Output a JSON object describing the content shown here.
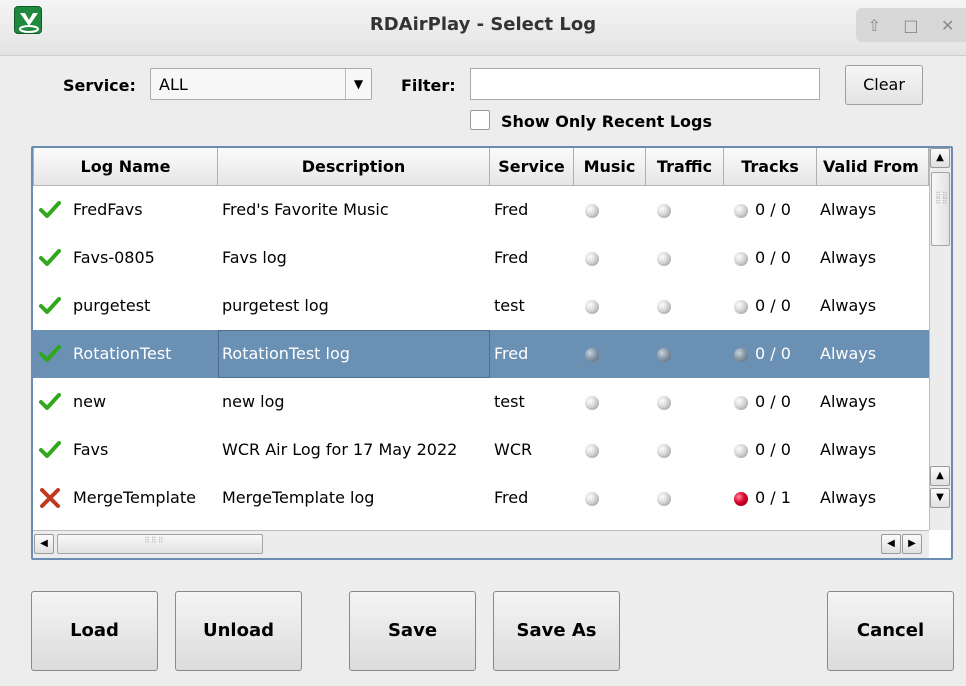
{
  "window": {
    "title": "RDAirPlay - Select Log",
    "controls": [
      "⇧",
      "□",
      "✕"
    ]
  },
  "toolbar": {
    "service_label": "Service:",
    "service_value": "ALL",
    "filter_label": "Filter:",
    "filter_value": "",
    "clear_label": "Clear",
    "recent_label": "Show Only Recent Logs",
    "recent_checked": false
  },
  "table": {
    "columns": [
      "Log Name",
      "Description",
      "Service",
      "Music",
      "Traffic",
      "Tracks",
      "Valid From"
    ],
    "rows": [
      {
        "status": "check-icon",
        "name": "FredFavs",
        "description": "Fred's Favorite Music",
        "service": "Fred",
        "music": "gray",
        "traffic": "gray",
        "tracks_led": "gray",
        "tracks": "0 / 0",
        "valid_from": "Always",
        "selected": false
      },
      {
        "status": "check-icon",
        "name": "Favs-0805",
        "description": "Favs log",
        "service": "Fred",
        "music": "gray",
        "traffic": "gray",
        "tracks_led": "gray",
        "tracks": "0 / 0",
        "valid_from": "Always",
        "selected": false
      },
      {
        "status": "check-icon",
        "name": "purgetest",
        "description": "purgetest log",
        "service": "test",
        "music": "gray",
        "traffic": "gray",
        "tracks_led": "gray",
        "tracks": "0 / 0",
        "valid_from": "Always",
        "selected": false
      },
      {
        "status": "check-icon",
        "name": "RotationTest",
        "description": "RotationTest log",
        "service": "Fred",
        "music": "gray",
        "traffic": "gray",
        "tracks_led": "gray",
        "tracks": "0 / 0",
        "valid_from": "Always",
        "selected": true
      },
      {
        "status": "check-icon",
        "name": "new",
        "description": "new log",
        "service": "test",
        "music": "gray",
        "traffic": "gray",
        "tracks_led": "gray",
        "tracks": "0 / 0",
        "valid_from": "Always",
        "selected": false
      },
      {
        "status": "check-icon",
        "name": "Favs",
        "description": "WCR Air Log for 17 May 2022",
        "service": "WCR",
        "music": "gray",
        "traffic": "gray",
        "tracks_led": "gray",
        "tracks": "0 / 0",
        "valid_from": "Always",
        "selected": false
      },
      {
        "status": "x-icon",
        "name": "MergeTemplate",
        "description": "MergeTemplate log",
        "service": "Fred",
        "music": "gray",
        "traffic": "gray",
        "tracks_led": "red",
        "tracks": "0 / 1",
        "valid_from": "Always",
        "selected": false
      }
    ]
  },
  "buttons": {
    "load": "Load",
    "unload": "Unload",
    "save": "Save",
    "save_as": "Save As",
    "cancel": "Cancel"
  },
  "colors": {
    "selection": "#6a90b3",
    "check": "#2fa81c",
    "x": "#c0391e",
    "led_red": "#d9002a"
  }
}
